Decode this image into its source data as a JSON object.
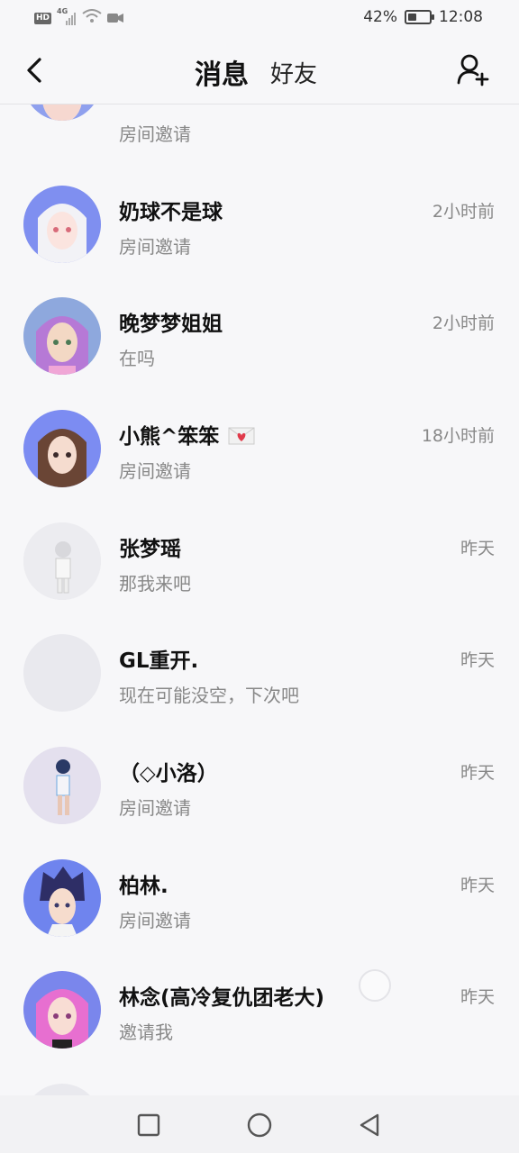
{
  "status_bar": {
    "hd": "HD",
    "network": "4G",
    "battery_text": "42%",
    "battery_level": 0.42,
    "time": "12:08"
  },
  "header": {
    "tab_messages": "消息",
    "tab_friends": "好友",
    "back_icon": "chevron-left-icon",
    "add_icon": "add-user-icon"
  },
  "conversations": [
    {
      "name": "",
      "preview": "房间邀请",
      "time": "",
      "avatar_color": "#8fa0ee"
    },
    {
      "name": "奶球不是球",
      "preview": "房间邀请",
      "time": "2小时前",
      "avatar_color": "#7f8ff0"
    },
    {
      "name": "晚梦梦姐姐",
      "preview": "在吗",
      "time": "2小时前",
      "avatar_color": "#8ea8dd"
    },
    {
      "name": "小熊^笨笨",
      "preview": "房间邀请",
      "time": "18小时前",
      "avatar_color": "#7c8cf2"
    },
    {
      "name": "张梦瑶",
      "preview": "那我来吧",
      "time": "昨天",
      "avatar_color": "#ececf0"
    },
    {
      "name": "GL重开.",
      "preview": "现在可能没空，下次吧",
      "time": "昨天",
      "avatar_color": "#e9e9ee"
    },
    {
      "name": "（◇小洛）",
      "preview": "房间邀请",
      "time": "昨天",
      "avatar_color": "#e4e0ee"
    },
    {
      "name": "柏林.",
      "preview": "房间邀请",
      "time": "昨天",
      "avatar_color": "#6f84ee"
    },
    {
      "name": "林念(高冷复仇团老大)",
      "preview": "邀请我",
      "time": "昨天",
      "avatar_color": "#7a86ec"
    }
  ]
}
